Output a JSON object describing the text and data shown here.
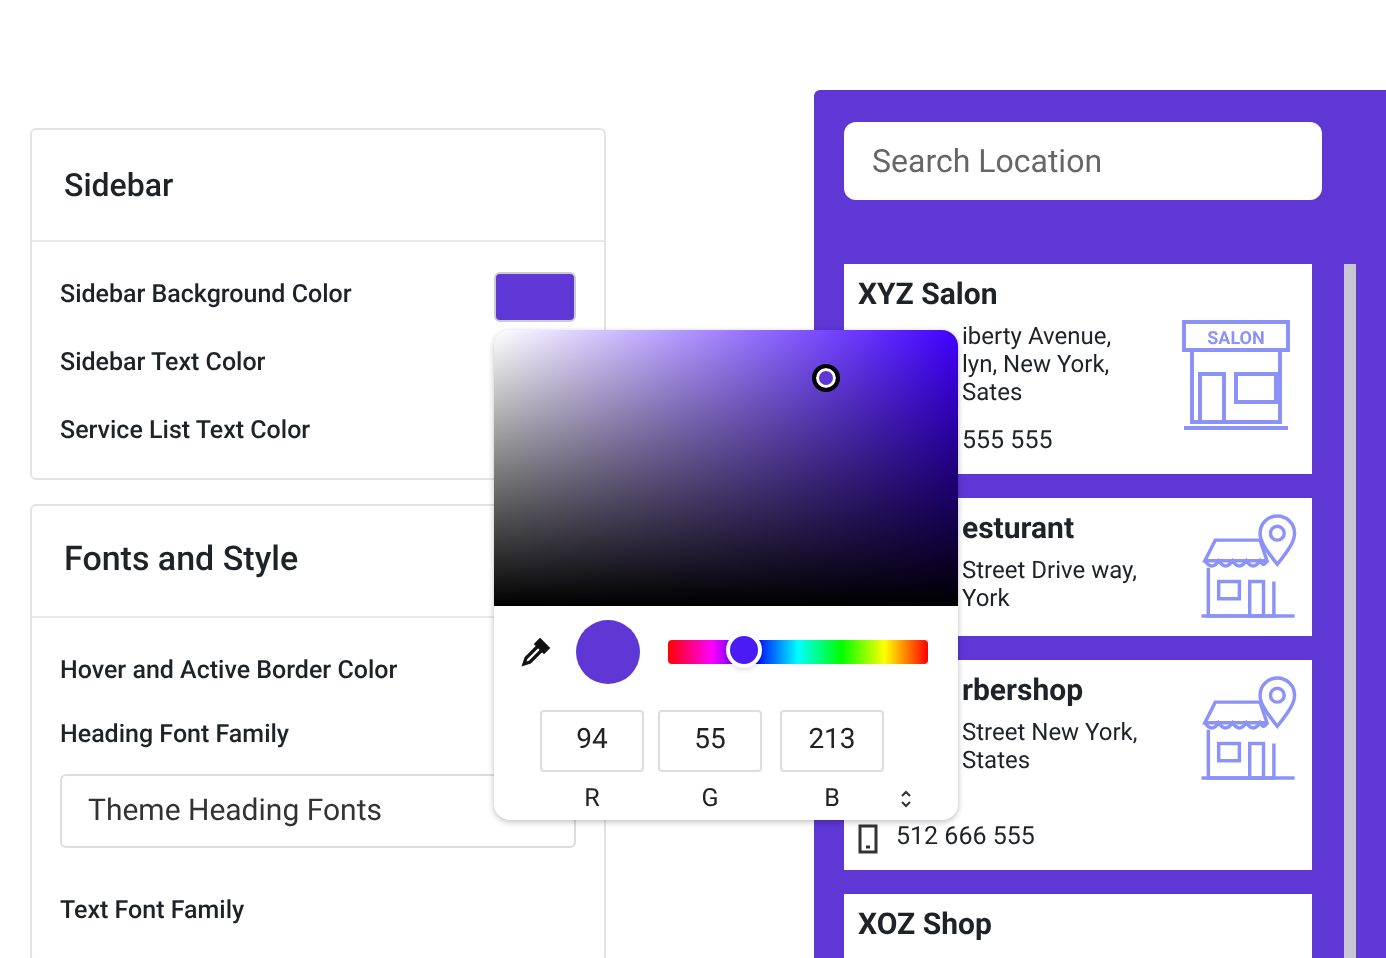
{
  "settings_sections": [
    {
      "title": "Sidebar",
      "fields": [
        {
          "kind": "color",
          "label": "Sidebar Background Color",
          "color": "#5e37d5"
        },
        {
          "kind": "label",
          "label": "Sidebar Text Color"
        },
        {
          "kind": "label",
          "label": "Service List Text Color"
        }
      ]
    },
    {
      "title": "Fonts and Style",
      "fields": [
        {
          "kind": "label",
          "label": "Hover and Active Border Color"
        },
        {
          "kind": "select",
          "label": "Heading Font Family",
          "value": "Theme Heading Fonts"
        },
        {
          "kind": "label",
          "label": "Text Font Family"
        }
      ]
    }
  ],
  "color_picker": {
    "color": "#5e37d5",
    "hue_slider": {
      "level": 0.29
    },
    "channels": [
      {
        "value": "94",
        "label": "R"
      },
      {
        "value": "55",
        "label": "G"
      },
      {
        "value": "213",
        "label": "B"
      }
    ]
  },
  "locations_panel": {
    "search": {
      "placeholder": "Search Location"
    },
    "locations": [
      {
        "name": "XYZ Salon",
        "address_lines": [
          "iberty Avenue,",
          "lyn, New York,",
          "Sates"
        ],
        "phone": "555 555",
        "kind": "salon",
        "sign": "SALON"
      },
      {
        "name": "esturant",
        "address_lines": [
          "Street Drive way,",
          "York"
        ],
        "kind": "store"
      },
      {
        "name": "rbershop",
        "address_lines": [
          "Street New York,",
          "States"
        ],
        "phone": "512 666 555",
        "kind": "store"
      },
      {
        "name": "XOZ Shop"
      }
    ]
  }
}
